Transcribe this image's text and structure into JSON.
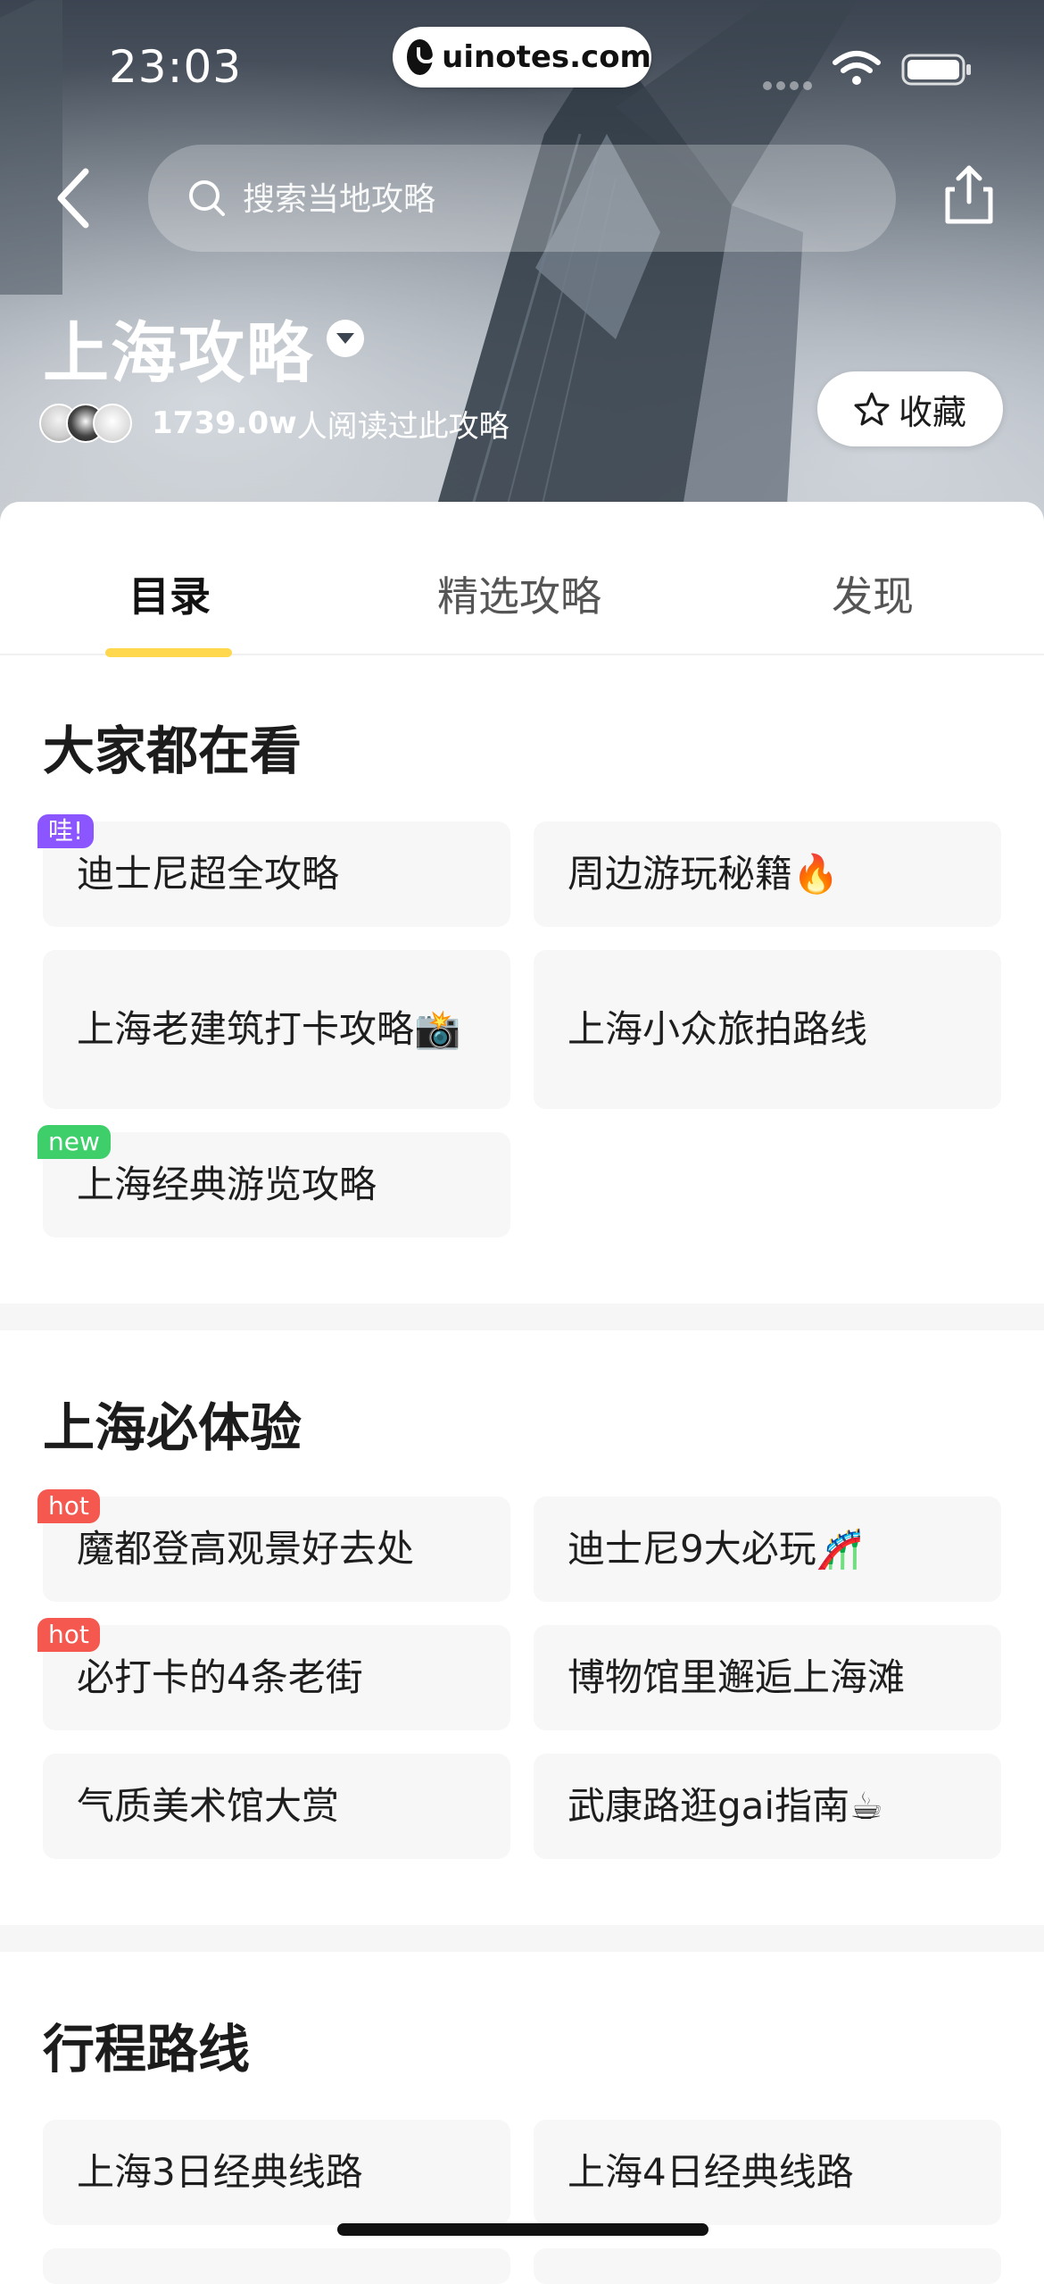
{
  "status_bar": {
    "time": "23:03",
    "url": "uinotes.com"
  },
  "header": {
    "search_placeholder": "搜索当地攻略",
    "title": "上海攻略",
    "readers_count": "1739.0w",
    "readers_text": "人阅读过此攻略",
    "favorite_label": "收藏"
  },
  "tabs": [
    {
      "label": "目录",
      "active": true
    },
    {
      "label": "精选攻略",
      "active": false
    },
    {
      "label": "发现",
      "active": false
    }
  ],
  "sections": [
    {
      "title": "大家都在看",
      "items": [
        {
          "label": "迪士尼超全攻略",
          "badge": "哇!"
        },
        {
          "label": "周边游玩秘籍🔥",
          "badge": ""
        },
        {
          "label": "上海老建筑打卡攻略📸",
          "badge": ""
        },
        {
          "label": "上海小众旅拍路线",
          "badge": ""
        },
        {
          "label": "上海经典游览攻略",
          "badge": "new"
        }
      ]
    },
    {
      "title": "上海必体验",
      "items": [
        {
          "label": "魔都登高观景好去处",
          "badge": "hot"
        },
        {
          "label": "迪士尼9大必玩🎢",
          "badge": ""
        },
        {
          "label": "必打卡的4条老街",
          "badge": "hot"
        },
        {
          "label": "博物馆里邂逅上海滩",
          "badge": ""
        },
        {
          "label": "气质美术馆大赏",
          "badge": ""
        },
        {
          "label": "武康路逛gai指南☕",
          "badge": ""
        }
      ]
    },
    {
      "title": "行程路线",
      "items": [
        {
          "label": "上海3日经典线路",
          "badge": ""
        },
        {
          "label": "上海4日经典线路",
          "badge": ""
        }
      ]
    }
  ],
  "colors": {
    "tab_indicator": "#ffd84d",
    "badge_wow": "#8b55ff",
    "badge_new": "#3ecf6b",
    "badge_hot": "#f4584f"
  }
}
